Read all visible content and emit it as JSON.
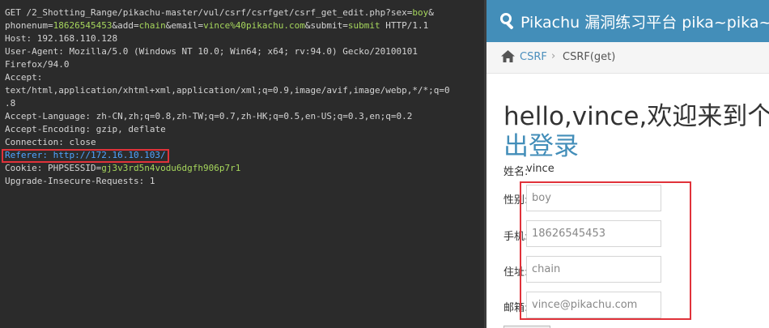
{
  "request": {
    "lines": [
      [
        {
          "t": "GET /2_Shotting_Range/pikachu-master/vul/csrf/csrfget/csrf_get_edit.php?sex=",
          "c": "k"
        },
        {
          "t": "boy",
          "c": "p"
        },
        {
          "t": "&",
          "c": "k"
        }
      ],
      [
        {
          "t": "phonenum=",
          "c": "k"
        },
        {
          "t": "18626545453",
          "c": "p"
        },
        {
          "t": "&add=",
          "c": "k"
        },
        {
          "t": "chain",
          "c": "p"
        },
        {
          "t": "&email=",
          "c": "k"
        },
        {
          "t": "vince%40pikachu.com",
          "c": "p"
        },
        {
          "t": "&submit=",
          "c": "k"
        },
        {
          "t": "submit",
          "c": "p"
        },
        {
          "t": " HTTP/1.1",
          "c": "k"
        }
      ],
      [
        {
          "t": "Host: ",
          "c": "k"
        },
        {
          "t": "192.168.110.128",
          "c": "v"
        }
      ],
      [
        {
          "t": "User-Agent: ",
          "c": "k"
        },
        {
          "t": "Mozilla/5.0 (Windows NT 10.0; Win64; x64; rv:94.0) Gecko/20100101",
          "c": "v"
        }
      ],
      [
        {
          "t": "Firefox/94.0",
          "c": "v"
        }
      ],
      [
        {
          "t": "Accept:",
          "c": "k"
        }
      ],
      [
        {
          "t": "text/html,application/xhtml+xml,application/xml;q=0.9,image/avif,image/webp,*/*;q=0",
          "c": "v"
        }
      ],
      [
        {
          "t": ".8",
          "c": "v"
        }
      ],
      [
        {
          "t": "Accept-Language: ",
          "c": "k"
        },
        {
          "t": "zh-CN,zh;q=0.8,zh-TW;q=0.7,zh-HK;q=0.5,en-US;q=0.3,en;q=0.2",
          "c": "v"
        }
      ],
      [
        {
          "t": "Accept-Encoding: ",
          "c": "k"
        },
        {
          "t": "gzip, deflate",
          "c": "v"
        }
      ],
      [
        {
          "t": "Connection: ",
          "c": "k"
        },
        {
          "t": "close",
          "c": "v"
        }
      ],
      [
        {
          "t": "Referer: http://172.16.10.103/",
          "c": "referer-line"
        }
      ],
      [
        {
          "t": "Cookie: PHPSESSID=",
          "c": "k"
        },
        {
          "t": "gj3v3rd5n4vodu6dgfh906p7r1",
          "c": "p"
        }
      ],
      [
        {
          "t": "Upgrade-Insecure-Requests: ",
          "c": "k"
        },
        {
          "t": "1",
          "c": "v"
        }
      ]
    ]
  },
  "browser": {
    "nav_title": "Pikachu 漏洞练习平台 pika~pika~",
    "breadcrumb_link": "CSRF",
    "breadcrumb_sep": "›",
    "breadcrumb_current": "CSRF(get)",
    "greeting": "hello,vince,欢迎来到个人会员中心 | 退",
    "logout": "出登录",
    "name_label": "姓名:",
    "name_value": "vince",
    "fields": {
      "sex": {
        "label": "性别:",
        "value": "boy"
      },
      "phone": {
        "label": "手机:",
        "value": "18626545453"
      },
      "address": {
        "label": "住址:",
        "value": "chain"
      },
      "email": {
        "label": "邮箱:",
        "value": "vince@pikachu.com"
      }
    }
  },
  "colors": {
    "highlight": "#e0323a",
    "nav": "#438eb9",
    "param": "#a6d65c",
    "referer": "#4fa3ff"
  }
}
